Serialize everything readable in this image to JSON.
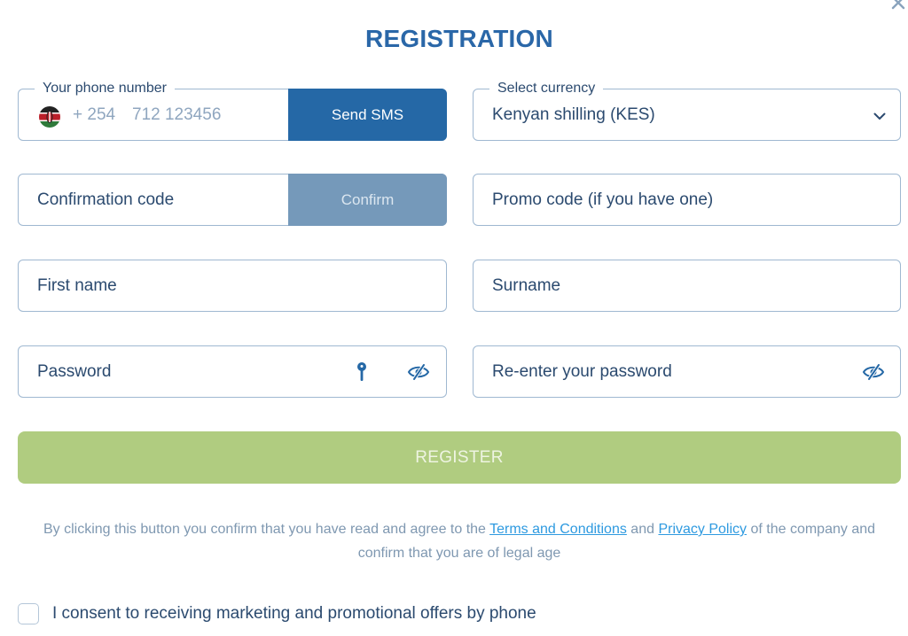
{
  "title": "REGISTRATION",
  "phone": {
    "legend": "Your phone number",
    "country_code": "+ 254",
    "placeholder": "712 123456",
    "send_sms_label": "Send SMS",
    "flag": "kenya-flag-icon"
  },
  "currency": {
    "legend": "Select currency",
    "selected": "Kenyan shilling (KES)"
  },
  "confirmation": {
    "placeholder": "Confirmation code",
    "confirm_label": "Confirm"
  },
  "promo": {
    "placeholder": "Promo code (if you have one)"
  },
  "first_name": {
    "placeholder": "First name"
  },
  "surname": {
    "placeholder": "Surname"
  },
  "password": {
    "placeholder": "Password"
  },
  "reenter_password": {
    "placeholder": "Re-enter your password"
  },
  "register_label": "REGISTER",
  "disclaimer": {
    "before": "By clicking this button you confirm that you have read and agree to the ",
    "terms_link": "Terms and Conditions",
    "and": " and ",
    "privacy_link": "Privacy Policy",
    "after": " of the company and confirm that you are of legal age"
  },
  "consent_label": "I consent to receiving marketing and promotional offers by phone",
  "colors": {
    "primary": "#2568a6",
    "title": "#2a67a8",
    "confirm_disabled": "#7599ba",
    "register_disabled": "#b0cc80",
    "link": "#2e9ae0",
    "border": "#9fb8d1"
  }
}
